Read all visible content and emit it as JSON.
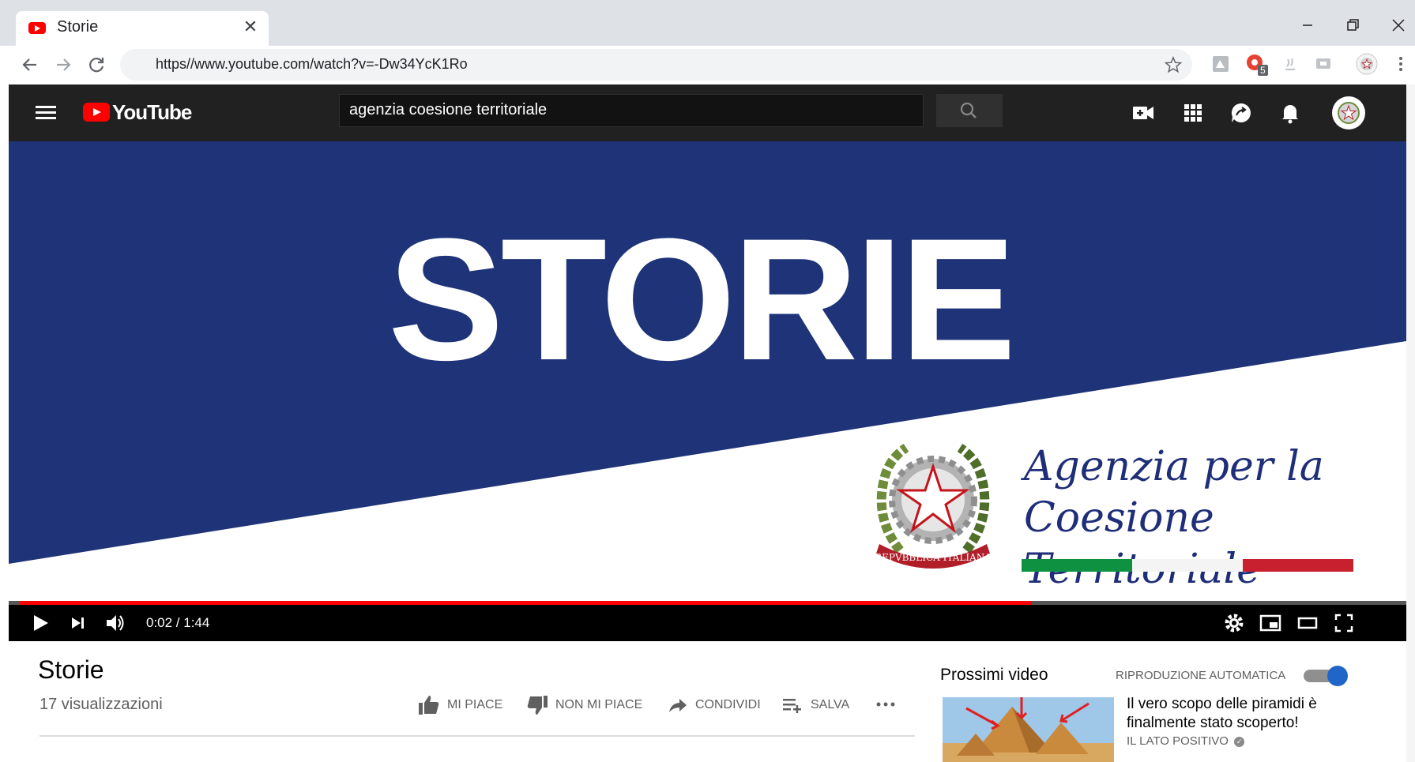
{
  "browser": {
    "tab_title": "Storie",
    "url": "https//www.youtube.com/watch?v=-Dw34YcK1Ro",
    "extension_badge": "5"
  },
  "youtube": {
    "logo_text": "YouTube",
    "search_value": "agenzia coesione territoriale"
  },
  "video": {
    "title_card": "STORIE",
    "brand_line1": "Agenzia per la",
    "brand_line2": "Coesione Territoriale",
    "emblem_text": "REPVBBLICA ITALIANA",
    "time_display": "0:02 / 1:44",
    "progress_fraction": 0.73,
    "colors": {
      "banner_blue": "#1f3478",
      "progress_red": "#ff0000"
    }
  },
  "page": {
    "title": "Storie",
    "views": "17 visualizzazioni",
    "actions": {
      "like": "MI PIACE",
      "dislike": "NON MI PIACE",
      "share": "CONDIVIDI",
      "save": "SALVA"
    }
  },
  "sidebar": {
    "next_label": "Prossimi video",
    "autoplay_label": "RIPRODUZIONE AUTOMATICA",
    "autoplay_on": true,
    "items": [
      {
        "title": "Il vero scopo delle piramidi è finalmente stato scoperto!",
        "channel": "IL LATO POSITIVO"
      }
    ]
  }
}
